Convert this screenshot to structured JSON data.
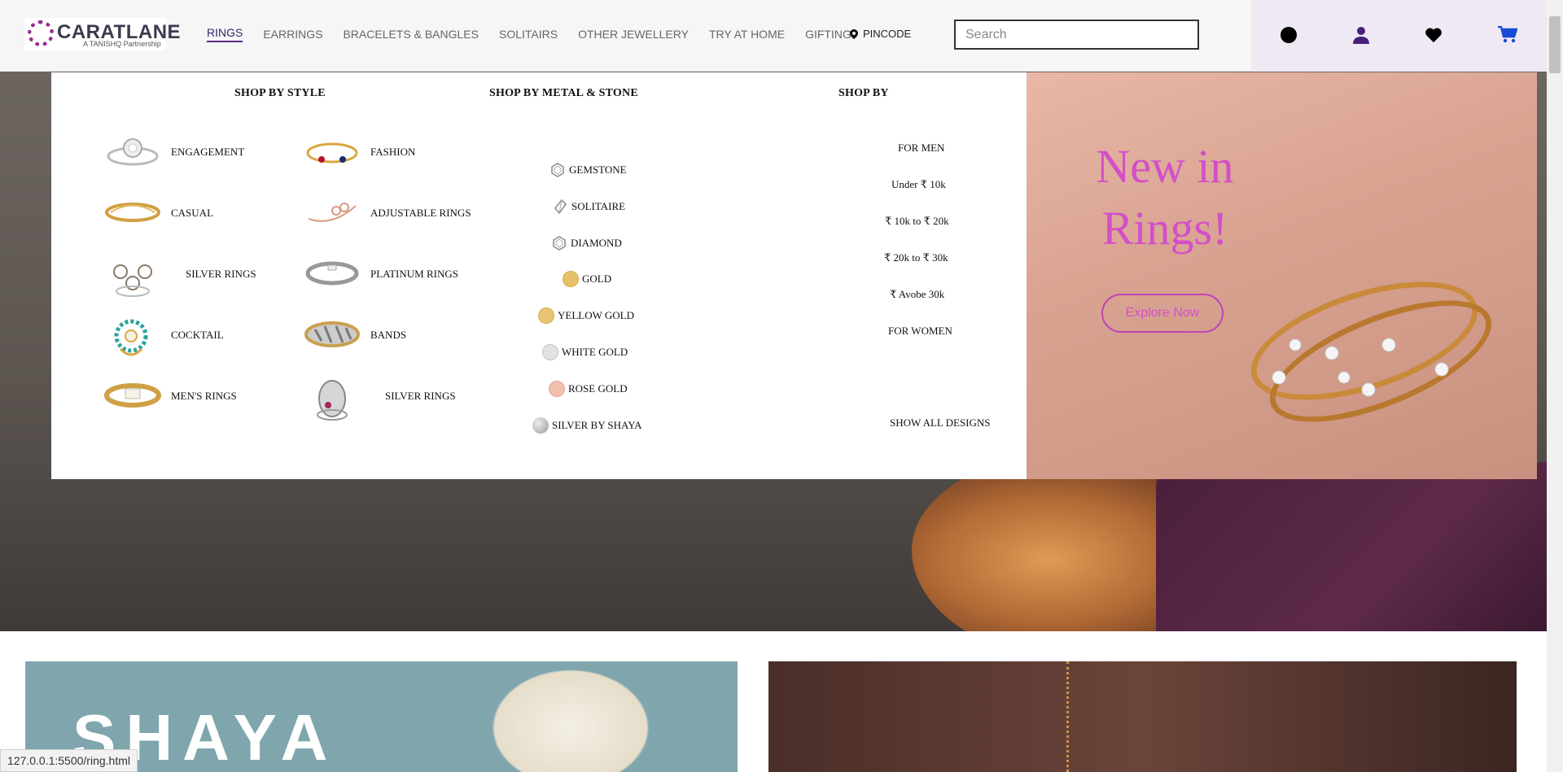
{
  "header": {
    "logo_text": "CARATLANE",
    "logo_sub": "A TANISHQ Partnership",
    "nav": [
      {
        "label": "RINGS",
        "active": true
      },
      {
        "label": "EARRINGS"
      },
      {
        "label": "BRACELETS & BANGLES"
      },
      {
        "label": "SOLITAIRS"
      },
      {
        "label": "OTHER JEWELLERY"
      },
      {
        "label": "TRY AT HOME"
      },
      {
        "label": "GIFTING"
      }
    ],
    "pincode_label": "PINCODE",
    "search_placeholder": "Search",
    "icons": [
      "circle-icon",
      "user-icon",
      "heart-icon",
      "cart-icon"
    ]
  },
  "mega_menu": {
    "shop_by_style": {
      "title": "SHOP BY STYLE",
      "items": [
        "ENGAGEMENT",
        "FASHION",
        "CASUAL",
        "ADJUSTABLE RINGS",
        "SILVER RINGS",
        "PLATINUM RINGS",
        "COCKTAIL",
        "BANDS",
        "MEN'S RINGS",
        "SILVER RINGS"
      ]
    },
    "shop_by_metal": {
      "title": "SHOP BY METAL & STONE",
      "items": [
        {
          "label": "GEMSTONE",
          "icon": "gemstone-icon"
        },
        {
          "label": "SOLITAIRE",
          "icon": "solitaire-icon"
        },
        {
          "label": "DIAMOND",
          "icon": "diamond-icon"
        },
        {
          "label": "GOLD",
          "color": "#e6c16a"
        },
        {
          "label": "YELLOW GOLD",
          "color": "#e8c474"
        },
        {
          "label": "WHITE GOLD",
          "color": "#e2e2e2"
        },
        {
          "label": "ROSE GOLD",
          "color": "#f2bfae"
        },
        {
          "label": "SILVER BY SHAYA",
          "color": "#bcbcbc"
        }
      ]
    },
    "shop_by": {
      "title": "SHOP BY",
      "items": [
        "FOR MEN",
        "Under ₹ 10k",
        "₹ 10k to ₹ 20k",
        "₹ 20k to ₹ 30k",
        "₹ Avobe 30k",
        "FOR WOMEN"
      ],
      "show_all": "SHOW ALL DESIGNS"
    }
  },
  "promo": {
    "title": "New in Rings!",
    "button": "Explore Now"
  },
  "cards": {
    "shaya_text": "SHAYA"
  },
  "status_url": "127.0.0.1:5500/ring.html"
}
